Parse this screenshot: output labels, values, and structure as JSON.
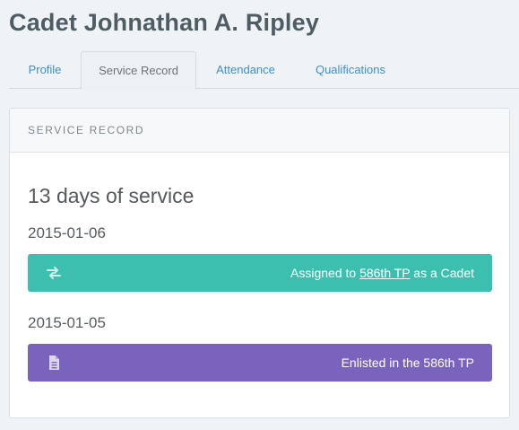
{
  "page": {
    "title": "Cadet Johnathan A. Ripley"
  },
  "tabs": [
    {
      "label": "Profile"
    },
    {
      "label": "Service Record"
    },
    {
      "label": "Attendance"
    },
    {
      "label": "Qualifications"
    }
  ],
  "panel": {
    "header": "SERVICE RECORD",
    "summary": "13 days of service",
    "entries": [
      {
        "date": "2015-01-06",
        "icon": "exchange-icon",
        "color": "#3dbfb0",
        "text_before": "Assigned to ",
        "link": "586th TP",
        "text_after": " as a Cadet"
      },
      {
        "date": "2015-01-05",
        "icon": "document-icon",
        "color": "#7a63bd",
        "text": "Enlisted in the 586th TP"
      }
    ]
  }
}
